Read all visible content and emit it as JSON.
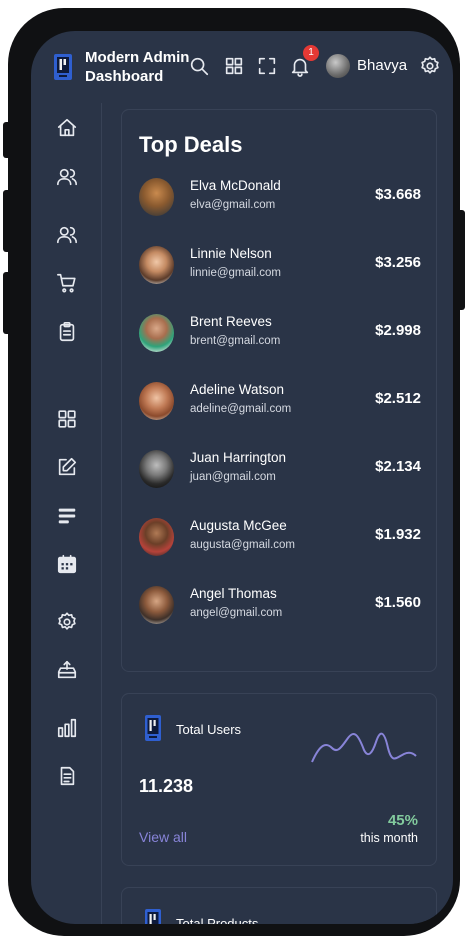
{
  "app": {
    "title": "Modern Admin Dashboard",
    "user_name": "Bhavya",
    "notification_count": "1"
  },
  "topbar_icons": [
    "search-icon",
    "apps-icon",
    "fullscreen-icon",
    "bell-icon",
    "settings-icon"
  ],
  "sidebar_icons": [
    "home-icon",
    "profile-icon",
    "users-icon",
    "cart-icon",
    "clipboard-icon",
    "grid-icon",
    "edit-icon",
    "bars-icon",
    "calendar-icon",
    "gear-icon",
    "upload-icon",
    "chart-icon",
    "document-icon"
  ],
  "top_deals": {
    "title": "Top Deals",
    "items": [
      {
        "name": "Elva McDonald",
        "email": "elva@gmail.com",
        "amount": "$3.668"
      },
      {
        "name": "Linnie Nelson",
        "email": "linnie@gmail.com",
        "amount": "$3.256"
      },
      {
        "name": "Brent Reeves",
        "email": "brent@gmail.com",
        "amount": "$2.998"
      },
      {
        "name": "Adeline Watson",
        "email": "adeline@gmail.com",
        "amount": "$2.512"
      },
      {
        "name": "Juan Harrington",
        "email": "juan@gmail.com",
        "amount": "$2.134"
      },
      {
        "name": "Augusta McGee",
        "email": "augusta@gmail.com",
        "amount": "$1.932"
      },
      {
        "name": "Angel Thomas",
        "email": "angel@gmail.com",
        "amount": "$1.560"
      }
    ]
  },
  "total_users": {
    "title": "Total Users",
    "value": "11.238",
    "link": "View all",
    "percent": "45%",
    "period": "this month",
    "line_color": "#8884d8",
    "positive_color": "#82ca9d"
  },
  "total_products": {
    "title": "Total Products"
  },
  "colors": {
    "background": "#2a3447",
    "border": "#384256",
    "accent": "#8884d8",
    "positive": "#82ca9d",
    "badge": "#e53935"
  }
}
